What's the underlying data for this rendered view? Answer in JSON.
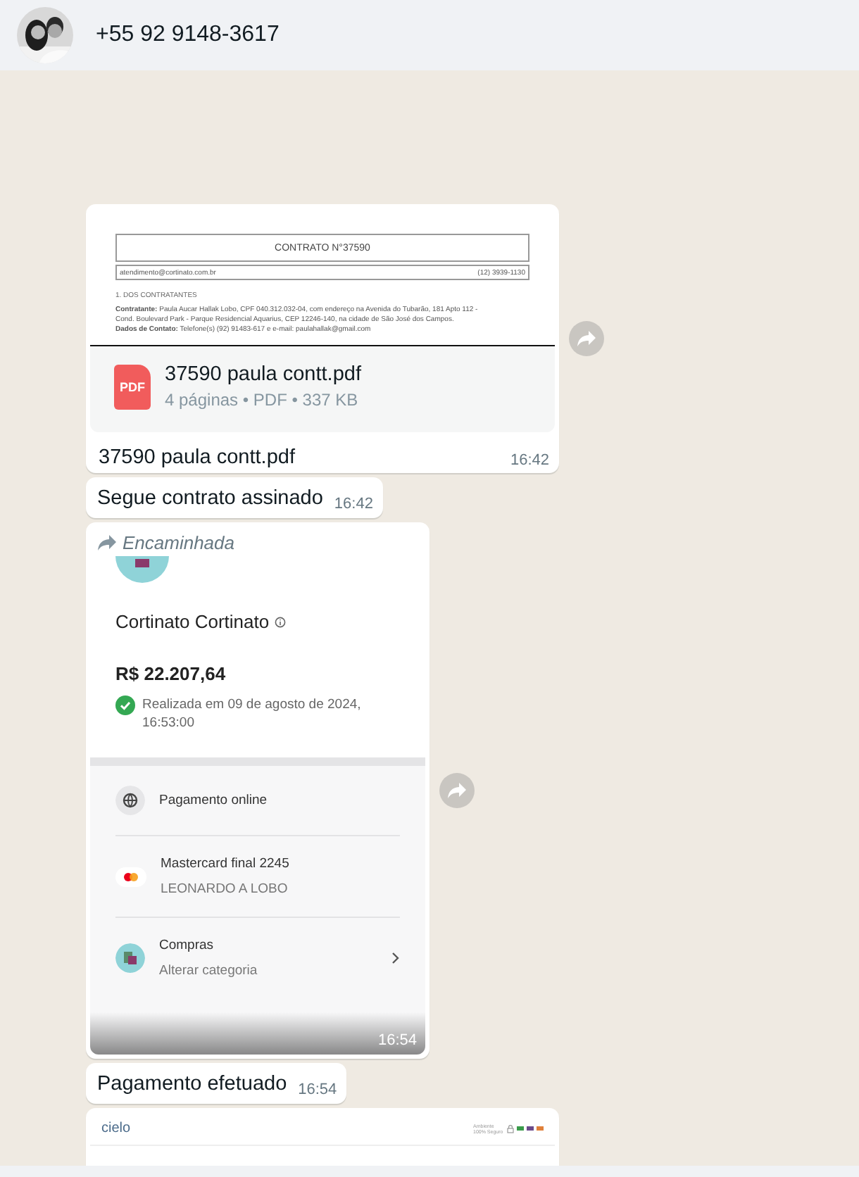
{
  "header": {
    "contact": "+55 92 9148-3617"
  },
  "messages": [
    {
      "kind": "document",
      "preview": {
        "title": "CONTRATO N°37590",
        "email": "atendimento@cortinato.com.br",
        "phone": "(12) 3939-1130",
        "section": "1. DOS CONTRATANTES",
        "lines": [
          "**Contratante:** Paula Aucar Hallak Lobo, CPF 040.312.032-04, com endereço na Avenida do Tubarão, 181 Apto 112 -",
          "Cond. Boulevard Park - Parque Residencial Aquarius, CEP 12246-140, na cidade de São José dos Campos.",
          "**Dados de Contato:** Telefone(s) (92) 91483-617 e e-mail: paulahallak@gmail.com"
        ]
      },
      "file_name": "37590 paula contt.pdf",
      "file_icon": "PDF",
      "file_meta": "4 páginas • PDF • 337 KB",
      "caption": "37590 paula contt.pdf",
      "time": "16:42",
      "forward_button": true
    },
    {
      "kind": "text",
      "text": "Segue contrato assinado",
      "time": "16:42",
      "forward_button": false
    },
    {
      "kind": "receipt",
      "forwarded_label": "Encaminhada",
      "receipt": {
        "merchant": "Cortinato Cortinato",
        "amount": "R$ 22.207,64",
        "status": "Realizada em 09 de agosto de 2024, 16:53:00",
        "rows": [
          {
            "kind": "globe",
            "title": "Pagamento online"
          },
          {
            "kind": "card",
            "title": "Mastercard final 2245",
            "subtitle": "LEONARDO A LOBO"
          },
          {
            "kind": "category",
            "title": "Compras",
            "subtitle": "Alterar categoria"
          }
        ]
      },
      "time": "16:54",
      "forward_button": true
    },
    {
      "kind": "text",
      "text": "Pagamento efetuado",
      "time": "16:54",
      "forward_button": false
    },
    {
      "kind": "checkout",
      "brand": "cielo",
      "badge": "Ambiente 100% Seguro",
      "forward_button": false
    }
  ]
}
